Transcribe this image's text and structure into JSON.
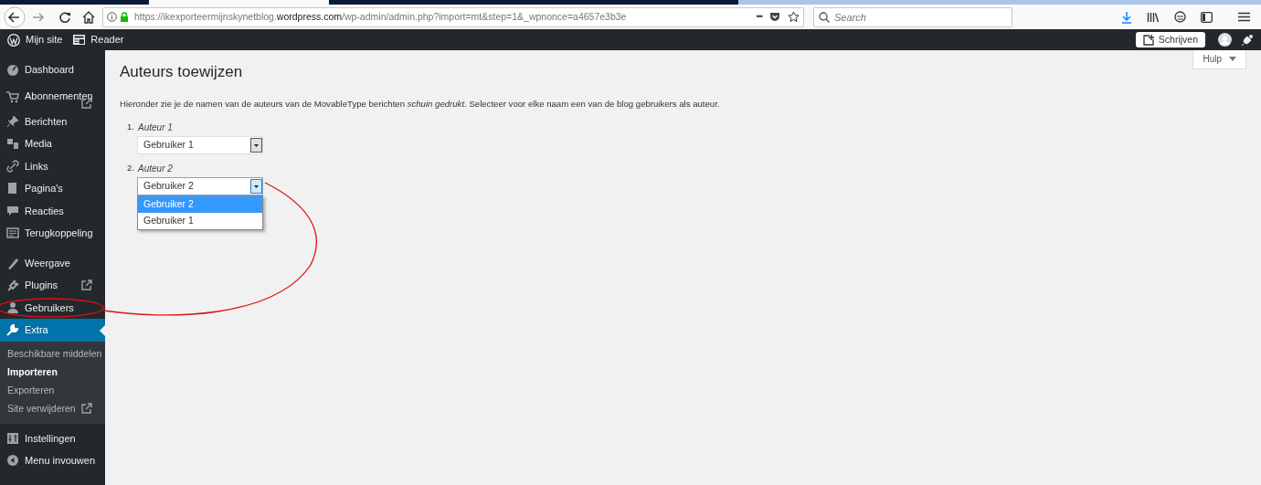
{
  "browser": {
    "url": "https://ikexporteermijnskynetblog.**wordpress.com**/wp-admin/admin.php?import=mt&step=1&_wpnonce=a4657e3b3e",
    "more": "•••",
    "search": {
      "placeholder": "Search"
    }
  },
  "admin_bar": {
    "site": "Mijn site",
    "reader": "Reader",
    "write": "Schrijven"
  },
  "sidebar": {
    "items": [
      {
        "label": "Dashboard",
        "selected": false,
        "external": false
      },
      {
        "label": "Abonnementen",
        "selected": false,
        "external": true
      },
      {
        "label": "Berichten",
        "selected": false,
        "external": false
      },
      {
        "label": "Media",
        "selected": false,
        "external": false
      },
      {
        "label": "Links",
        "selected": false,
        "external": false
      },
      {
        "label": "Pagina's",
        "selected": false,
        "external": false
      },
      {
        "label": "Reacties",
        "selected": false,
        "external": false
      },
      {
        "label": "Terugkoppeling",
        "selected": false,
        "external": false
      },
      {
        "label": "Weergave",
        "selected": false,
        "external": false
      },
      {
        "label": "Plugins",
        "selected": false,
        "external": true
      },
      {
        "label": "Gebruikers",
        "selected": false,
        "external": false
      },
      {
        "label": "Extra",
        "selected": true,
        "external": false,
        "children": [
          {
            "label": "Beschikbare middelen",
            "selected": false,
            "external": false
          },
          {
            "label": "Importeren",
            "selected": true,
            "external": false
          },
          {
            "label": "Exporteren",
            "selected": false,
            "external": false
          },
          {
            "label": "Site verwijderen",
            "selected": false,
            "external": true
          }
        ]
      },
      {
        "label": "Instellingen",
        "selected": false,
        "external": false
      },
      {
        "label": "Menu invouwen",
        "selected": false,
        "external": false
      }
    ]
  },
  "help": "Hulp",
  "page": {
    "title": "Auteurs toewijzen",
    "intro": "Hieronder zie je de namen van de auteurs van de MovableType berichten *schuin gedrukt*. Selecteer voor elke naam een van de blog gebruikers als auteur.",
    "authors": [
      {
        "number": "1.",
        "label": "Auteur 1",
        "value": "Gebruiker 1",
        "open": false
      },
      {
        "number": "2.",
        "label": "Auteur 2",
        "value": "Gebruiker 2",
        "open": true,
        "options": [
          {
            "label": "Gebruiker 2",
            "selected": true
          },
          {
            "label": "Gebruiker 1",
            "selected": false
          }
        ]
      }
    ]
  }
}
